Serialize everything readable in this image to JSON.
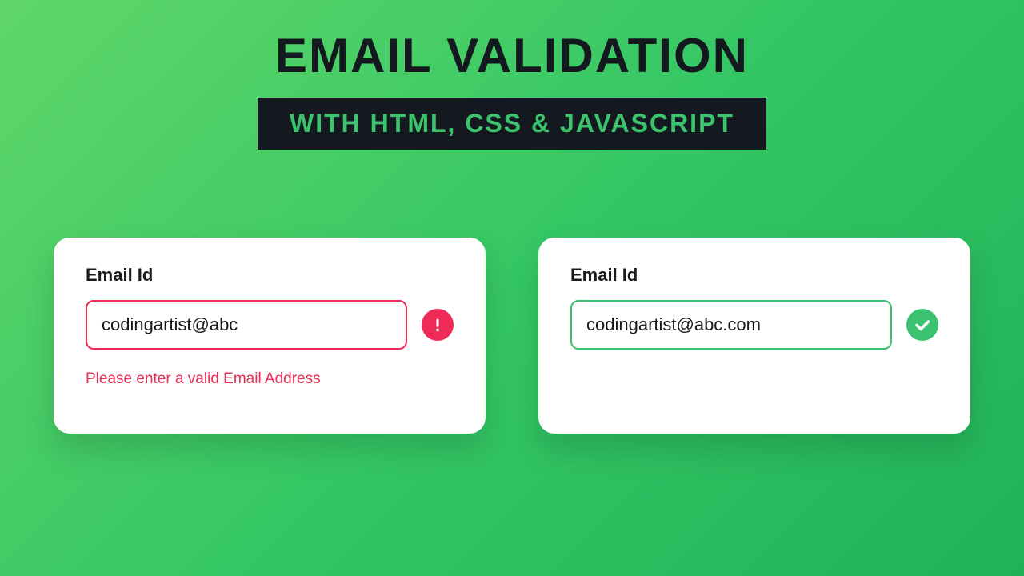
{
  "header": {
    "title": "EMAIL VALIDATION",
    "subtitle": "WITH HTML, CSS & JAVASCRIPT"
  },
  "cards": {
    "invalid": {
      "label": "Email Id",
      "value": "codingartist@abc",
      "error_message": "Please enter a valid Email Address"
    },
    "valid": {
      "label": "Email Id",
      "value": "codingartist@abc.com"
    }
  },
  "colors": {
    "error": "#ed2b56",
    "success": "#3bc271",
    "dark": "#14191f"
  }
}
